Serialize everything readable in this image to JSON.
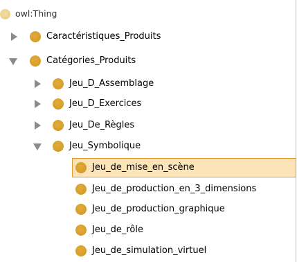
{
  "tree": {
    "root": {
      "label": "owl:Thing",
      "icon": "class-bullet-icon"
    },
    "nodes": [
      {
        "id": "caracteristiques",
        "label": "Caractéristiques_Produits",
        "expanded": false,
        "depth": 1
      },
      {
        "id": "categories",
        "label": "Catégories_Produits",
        "expanded": true,
        "depth": 1
      },
      {
        "id": "assemblage",
        "label": "Jeu_D_Assemblage",
        "expanded": false,
        "depth": 2
      },
      {
        "id": "exercices",
        "label": "Jeu_D_Exercices",
        "expanded": false,
        "depth": 2
      },
      {
        "id": "regles",
        "label": "Jeu_De_Règles",
        "expanded": false,
        "depth": 2
      },
      {
        "id": "symbolique",
        "label": "Jeu_Symbolique",
        "expanded": true,
        "depth": 2
      },
      {
        "id": "mise-en-scene",
        "label": "Jeu_de_mise_en_scène",
        "selected": true,
        "depth": 3
      },
      {
        "id": "production-3d",
        "label": "Jeu_de_production_en_3_dimensions",
        "depth": 3
      },
      {
        "id": "production-graphique",
        "label": "Jeu_de_production_graphique",
        "depth": 3
      },
      {
        "id": "role",
        "label": "Jeu_de_rôle",
        "depth": 3
      },
      {
        "id": "simulation-virtuel",
        "label": "Jeu_de_simulation_virtuel",
        "depth": 3
      }
    ]
  },
  "colors": {
    "class_bullet": "#d9a02c",
    "root_bullet": "#eed38f",
    "toggle_arrow": "#8a8a8a",
    "selection_background": "#fce3b8",
    "selection_border": "#e29c2a",
    "panel_border": "#b9b9b9"
  }
}
